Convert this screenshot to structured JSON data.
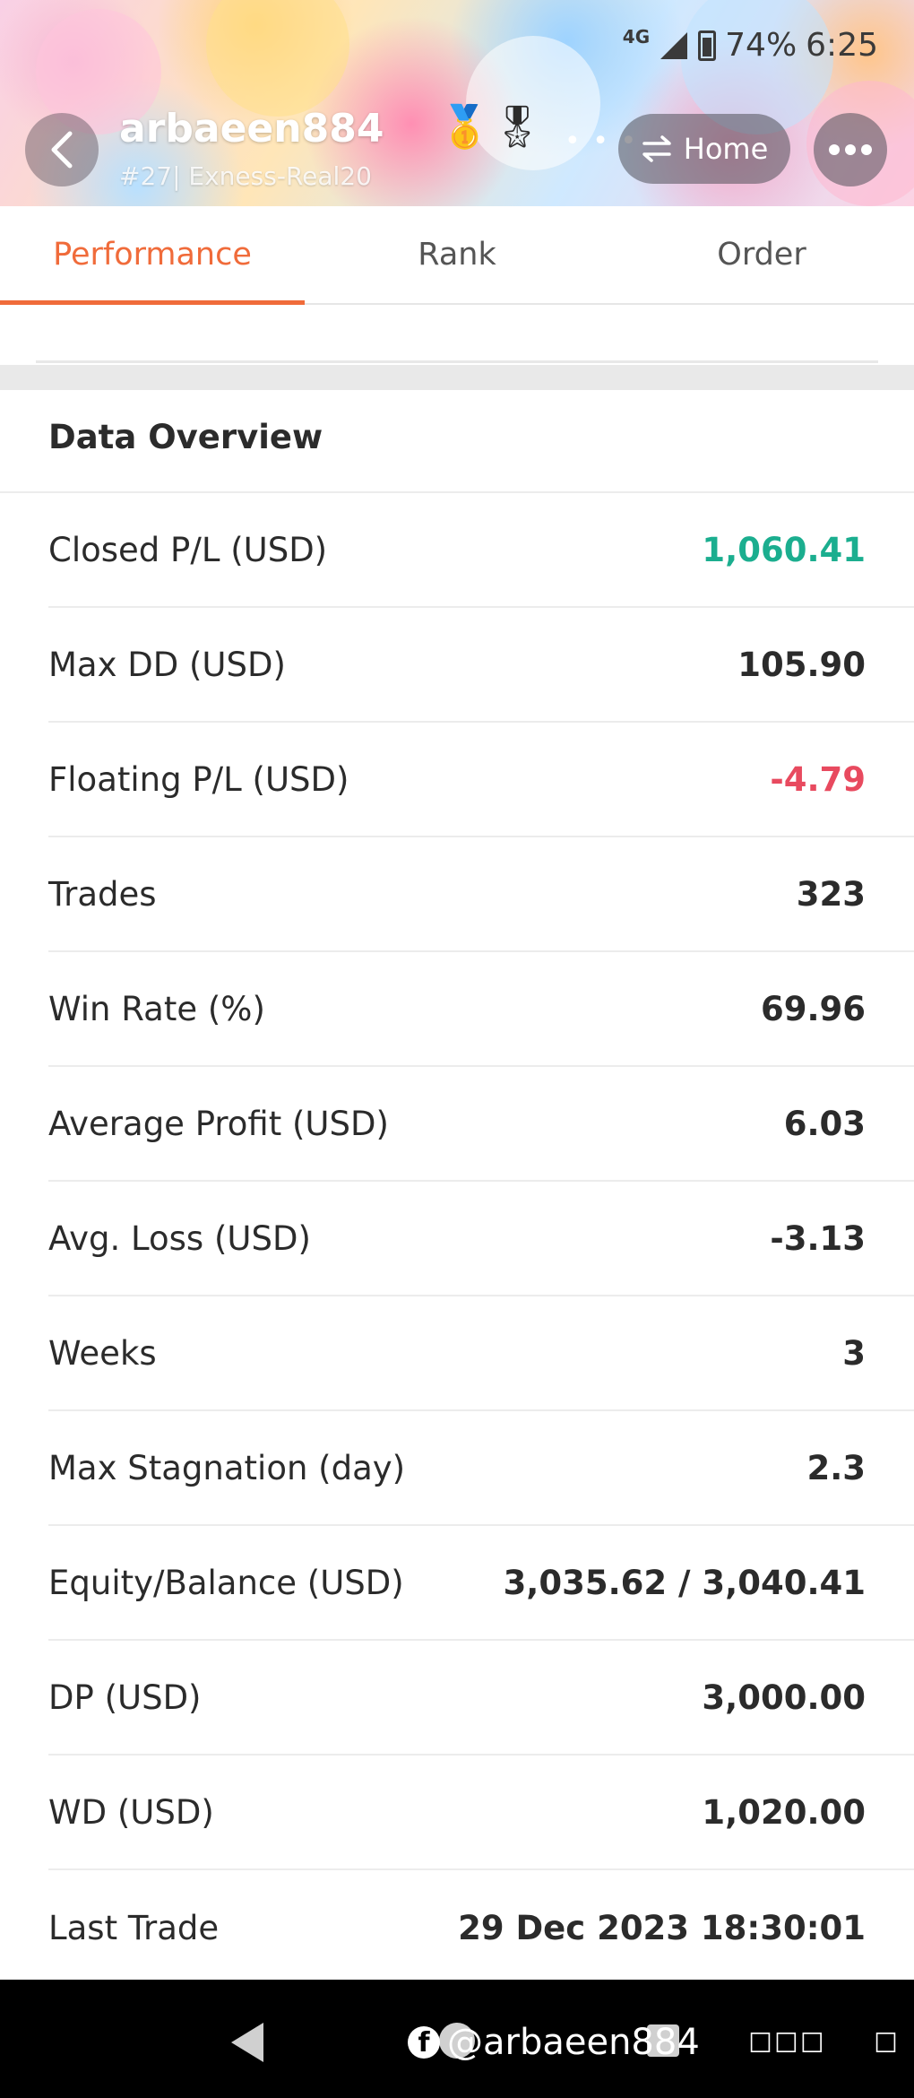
{
  "status_bar": {
    "network": "4G",
    "battery": "74%",
    "time": "6:25"
  },
  "header": {
    "username": "arbaeen884",
    "subtitle": "#27| Exness-Real20",
    "medal_1": "🥇",
    "medal_2": "🎖",
    "home_label": "Home"
  },
  "tabs": [
    {
      "label": "Performance",
      "active": true
    },
    {
      "label": "Rank",
      "active": false
    },
    {
      "label": "Order",
      "active": false
    }
  ],
  "overview": {
    "title": "Data Overview",
    "rows": [
      {
        "label": "Closed P/L (USD)",
        "value": "1,060.41",
        "tone": "pos"
      },
      {
        "label": "Max DD (USD)",
        "value": "105.90",
        "tone": "neutral"
      },
      {
        "label": "Floating P/L (USD)",
        "value": "-4.79",
        "tone": "neg"
      },
      {
        "label": "Trades",
        "value": "323",
        "tone": "neutral"
      },
      {
        "label": "Win Rate (%)",
        "value": "69.96",
        "tone": "neutral"
      },
      {
        "label": "Average Profit (USD)",
        "value": "6.03",
        "tone": "neutral"
      },
      {
        "label": "Avg. Loss (USD)",
        "value": "-3.13",
        "tone": "neutral"
      },
      {
        "label": "Weeks",
        "value": "3",
        "tone": "neutral"
      },
      {
        "label": "Max Stagnation (day)",
        "value": "2.3",
        "tone": "neutral"
      },
      {
        "label": "Equity/Balance (USD)",
        "value": "3,035.62 / 3,040.41",
        "tone": "neutral"
      },
      {
        "label": "DP (USD)",
        "value": "3,000.00",
        "tone": "neutral"
      },
      {
        "label": "WD (USD)",
        "value": "1,020.00",
        "tone": "neutral"
      },
      {
        "label": "Last Trade",
        "value": "29 Dec 2023 18:30:01",
        "tone": "neutral"
      }
    ]
  },
  "watermark": {
    "icon": "facebook-icon",
    "text": "@arbaeen884"
  },
  "colors": {
    "accent": "#f06b3a",
    "positive": "#1bae8f",
    "negative": "#e84a5f"
  }
}
